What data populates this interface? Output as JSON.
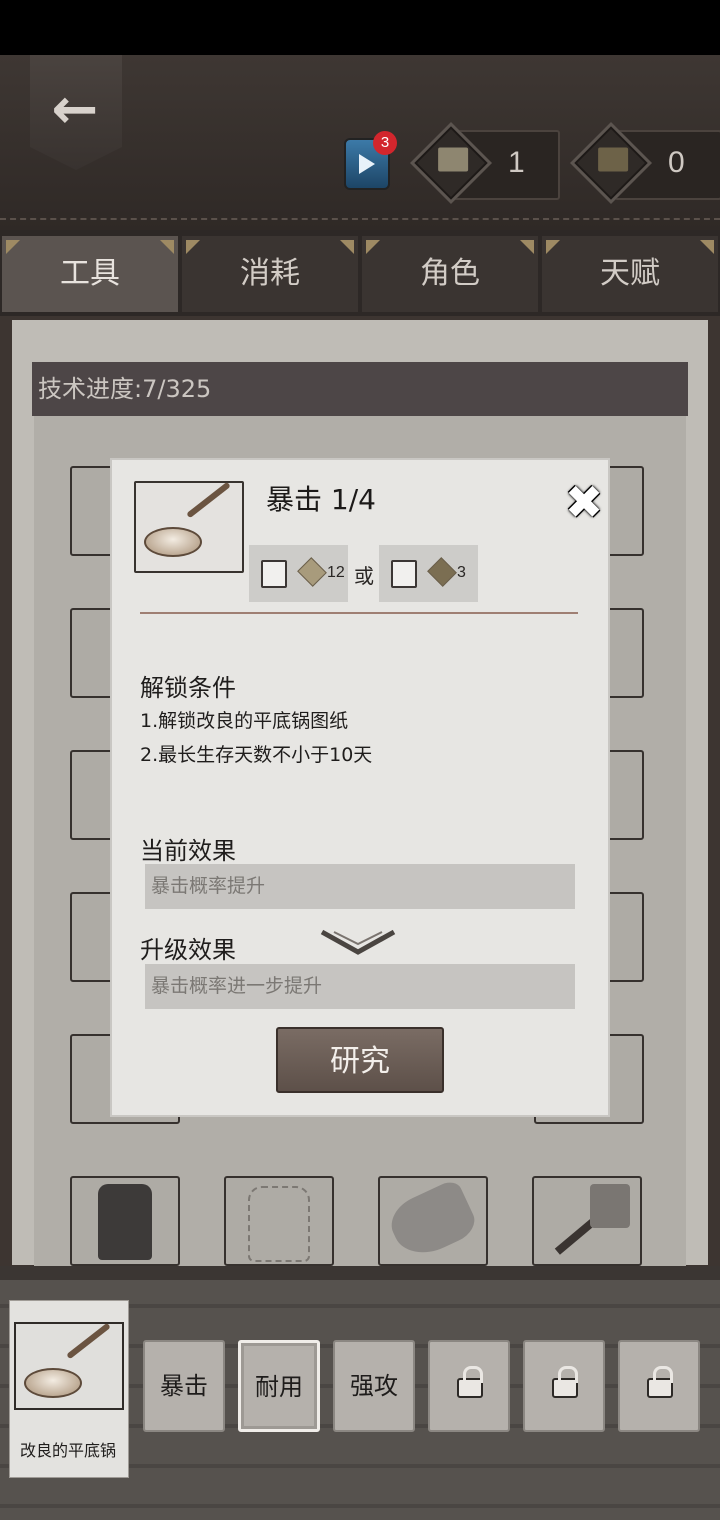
{
  "header": {
    "video_badge_count": "3",
    "resource_1_value": "1",
    "resource_2_value": "0"
  },
  "tabs": [
    {
      "label": "工具",
      "active": true
    },
    {
      "label": "消耗",
      "active": false
    },
    {
      "label": "角色",
      "active": false
    },
    {
      "label": "天赋",
      "active": false
    }
  ],
  "main": {
    "progress_text": "技术进度:7/325"
  },
  "popup": {
    "title": "暴击 1/4",
    "cost_option_1_amount": "12",
    "or_text": "或",
    "cost_option_2_amount": "3",
    "unlock_title": "解锁条件",
    "conditions": [
      "1.解锁改良的平底锅图纸",
      "2.最长生存天数不小于10天"
    ],
    "current_effect_title": "当前效果",
    "current_effect_text": "暴击概率提升",
    "upgrade_effect_title": "升级效果",
    "upgrade_effect_text": "暴击概率进一步提升",
    "research_label": "研究"
  },
  "bottom": {
    "selected_item_label": "改良的平底锅",
    "skills": [
      {
        "label": "暴击",
        "locked": false
      },
      {
        "label": "耐用",
        "locked": false,
        "active": true
      },
      {
        "label": "强攻",
        "locked": false
      },
      {
        "label": "",
        "locked": true
      },
      {
        "label": "",
        "locked": true
      },
      {
        "label": "",
        "locked": true
      }
    ]
  },
  "colors": {
    "header_leather": "#3e3733",
    "parchment": "#bfbcb6",
    "popup_bg": "#e7e6e3",
    "research_button": "#6b5d55",
    "badge": "#d2262d"
  }
}
